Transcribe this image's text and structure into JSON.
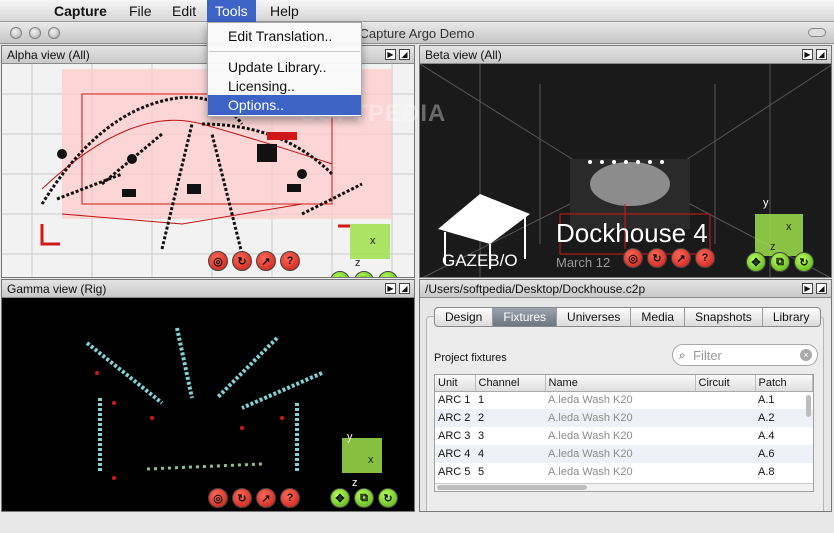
{
  "menubar": {
    "app_name": "Capture",
    "items": [
      "File",
      "Edit",
      "Tools",
      "Help"
    ]
  },
  "window": {
    "title": "Capture Argo Demo"
  },
  "tools_menu": {
    "items": [
      "Edit Translation..",
      "Update Library..",
      "Licensing..",
      "Options.."
    ],
    "highlighted": "Options.."
  },
  "watermark": "SOFTPEDIA",
  "panels": {
    "alpha": {
      "title": "Alpha view  (All)"
    },
    "beta": {
      "title": "Beta view  (All)",
      "scene_title": "Dockhouse 4",
      "scene_subtitle": "March 12",
      "sign": "GAZEB/O"
    },
    "gamma": {
      "title": "Gamma view  (Rig)"
    },
    "file": {
      "title": "/Users/softpedia/Desktop/Dockhouse.c2p"
    }
  },
  "axes": {
    "x": "x",
    "y": "y",
    "z": "z"
  },
  "tabs": [
    "Design",
    "Fixtures",
    "Universes",
    "Media",
    "Snapshots",
    "Library"
  ],
  "selected_tab": "Fixtures",
  "fixtures": {
    "label": "Project fixtures",
    "filter_placeholder": "Filter",
    "columns": [
      "Unit",
      "Channel",
      "Name",
      "Circuit",
      "Patch"
    ],
    "rows": [
      {
        "unit": "ARC 1",
        "channel": "1",
        "name": "A.leda Wash K20",
        "circuit": "",
        "patch": "A.1"
      },
      {
        "unit": "ARC 2",
        "channel": "2",
        "name": "A.leda Wash K20",
        "circuit": "",
        "patch": "A.2"
      },
      {
        "unit": "ARC 3",
        "channel": "3",
        "name": "A.leda Wash K20",
        "circuit": "",
        "patch": "A.4"
      },
      {
        "unit": "ARC 4",
        "channel": "4",
        "name": "A.leda Wash K20",
        "circuit": "",
        "patch": "A.6"
      },
      {
        "unit": "ARC 5",
        "channel": "5",
        "name": "A.leda Wash K20",
        "circuit": "",
        "patch": "A.8"
      }
    ]
  },
  "colors": {
    "menu_highlight": "#3d63c6",
    "control_red": "#d22a1c",
    "control_green": "#6bc21e",
    "truss_cyan": "#7fd2d8",
    "selected_tab": "#7a838d"
  }
}
